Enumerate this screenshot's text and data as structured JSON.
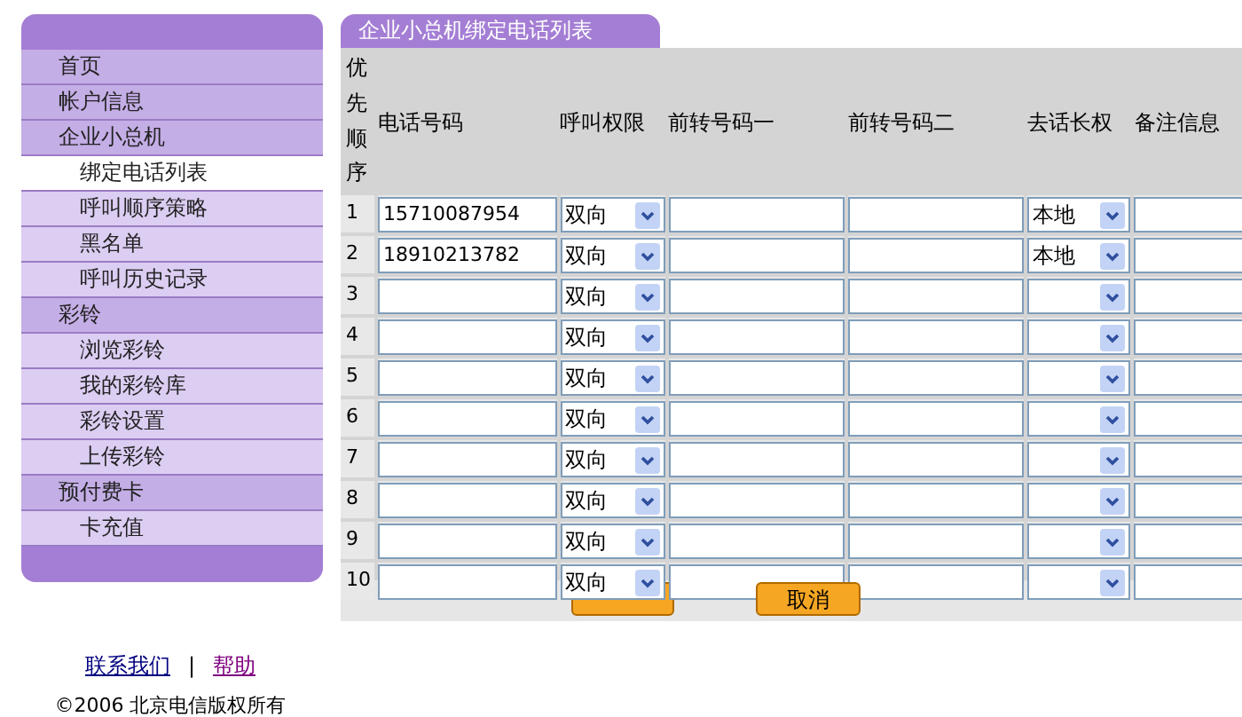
{
  "sidebar": {
    "items": [
      {
        "label": "首页",
        "kind": "section",
        "selected": false
      },
      {
        "label": "帐户信息",
        "kind": "section",
        "selected": false
      },
      {
        "label": "企业小总机",
        "kind": "section",
        "selected": false
      },
      {
        "label": "绑定电话列表",
        "kind": "sub",
        "selected": true
      },
      {
        "label": "呼叫顺序策略",
        "kind": "sub",
        "selected": false
      },
      {
        "label": "黑名单",
        "kind": "sub",
        "selected": false
      },
      {
        "label": "呼叫历史记录",
        "kind": "sub",
        "selected": false
      },
      {
        "label": "彩铃",
        "kind": "section",
        "selected": false
      },
      {
        "label": "浏览彩铃",
        "kind": "sub",
        "selected": false
      },
      {
        "label": "我的彩铃库",
        "kind": "sub",
        "selected": false
      },
      {
        "label": "彩铃设置",
        "kind": "sub",
        "selected": false
      },
      {
        "label": "上传彩铃",
        "kind": "sub",
        "selected": false
      },
      {
        "label": "预付费卡",
        "kind": "section",
        "selected": false
      },
      {
        "label": "卡充值",
        "kind": "sub",
        "selected": false
      }
    ]
  },
  "panel": {
    "title": "企业小总机绑定电话列表",
    "columns": [
      "优先顺序",
      "电话号码",
      "呼叫权限",
      "前转号码一",
      "前转号码二",
      "去话长权",
      "备注信息"
    ],
    "rows": [
      {
        "order": "1",
        "phone": "15710087954",
        "permission": "双向",
        "long_distance": "本地"
      },
      {
        "order": "2",
        "phone": "18910213782",
        "permission": "双向",
        "long_distance": "本地"
      },
      {
        "order": "3",
        "permission": "双向"
      },
      {
        "order": "4",
        "permission": "双向"
      },
      {
        "order": "5",
        "permission": "双向"
      },
      {
        "order": "6",
        "permission": "双向"
      },
      {
        "order": "7",
        "permission": "双向"
      },
      {
        "order": "8",
        "permission": "双向"
      },
      {
        "order": "9",
        "permission": "双向"
      },
      {
        "order": "10",
        "permission": "双向"
      }
    ],
    "cancel_button": "取消"
  },
  "footer": {
    "links": [
      {
        "label": "联系我们",
        "visited": false
      },
      {
        "label": "帮助",
        "visited": true
      }
    ],
    "separator": "|",
    "copyright": "©2006 北京电信版权所有"
  }
}
